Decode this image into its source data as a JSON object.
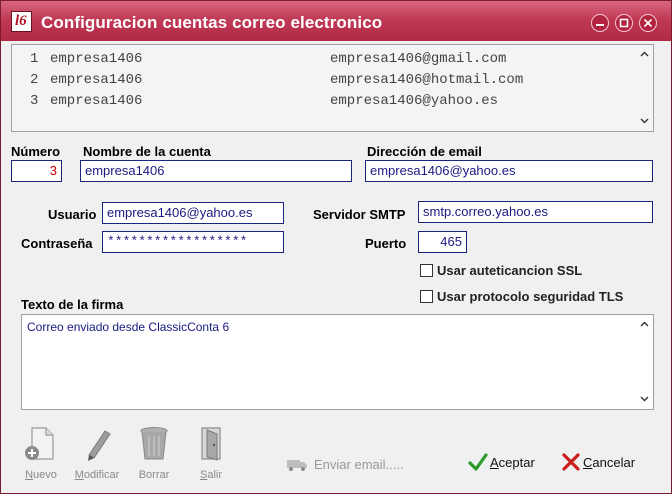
{
  "window": {
    "title": "Configuracion cuentas correo electronico",
    "controls": [
      "minimize",
      "maximize",
      "close"
    ]
  },
  "accounts_list": {
    "rows": [
      {
        "num": "1",
        "name": "empresa1406",
        "email": "empresa1406@gmail.com"
      },
      {
        "num": "2",
        "name": "empresa1406",
        "email": "empresa1406@hotmail.com"
      },
      {
        "num": "3",
        "name": "empresa1406",
        "email": "empresa1406@yahoo.es"
      }
    ]
  },
  "form": {
    "numero_label": "Número",
    "numero_value": "3",
    "nombre_label": "Nombre de la cuenta",
    "nombre_value": "empresa1406",
    "direccion_label": "Dirección de email",
    "direccion_value": "empresa1406@yahoo.es",
    "usuario_label": "Usuario",
    "usuario_value": "empresa1406@yahoo.es",
    "contrasena_label": "Contraseña",
    "contrasena_value": "******************",
    "servidor_label": "Servidor SMTP",
    "servidor_value": "smtp.correo.yahoo.es",
    "puerto_label": "Puerto",
    "puerto_value": "465",
    "ssl_label": "Usar auteticancion SSL",
    "ssl_checked": false,
    "tls_label": "Usar protocolo seguridad TLS",
    "tls_checked": false,
    "firma_label": "Texto de la firma",
    "firma_value": "Correo enviado desde ClassicConta 6"
  },
  "toolbar": {
    "nuevo_first": "N",
    "nuevo_rest": "uevo",
    "modificar_first": "M",
    "modificar_rest": "odificar",
    "borrar": "Borrar",
    "salir_first": "S",
    "salir_rest": "alir",
    "enviar": "Enviar email.....",
    "aceptar_first": "A",
    "aceptar_rest": "ceptar",
    "cancelar_first": "C",
    "cancelar_rest": "ancelar"
  },
  "icons": {
    "app": "ledger-icon",
    "nuevo": "new-document-icon",
    "modificar": "pencil-icon",
    "borrar": "trash-icon",
    "salir": "exit-door-icon",
    "enviar": "mail-truck-icon",
    "aceptar": "checkmark-icon",
    "cancelar": "x-icon"
  },
  "colors": {
    "titlebar": "#c03a56",
    "field_text": "#1a1a80",
    "numero_text": "#c00000",
    "aceptar_icon": "#2a9a2a",
    "cancelar_icon": "#c81e1e"
  }
}
